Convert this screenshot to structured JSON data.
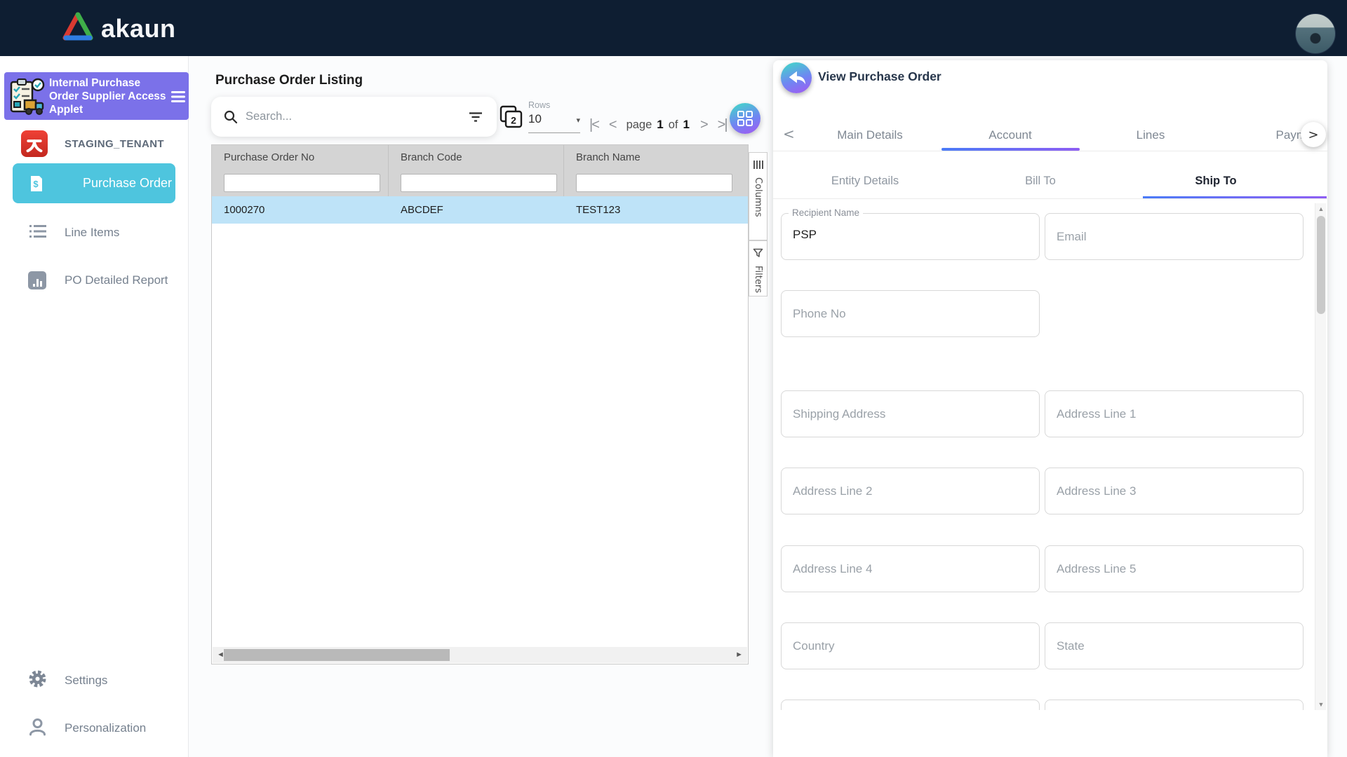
{
  "navbar": {
    "logo_text": "akaun"
  },
  "sidebar": {
    "applet_title": "Internal Purchase Order Supplier Access Applet",
    "tenant": {
      "label": "STAGING_TENANT"
    },
    "items": [
      {
        "label": "Purchase Order",
        "active": true
      },
      {
        "label": "Line Items"
      },
      {
        "label": "PO Detailed Report"
      }
    ],
    "footer": [
      {
        "label": "Settings"
      },
      {
        "label": "Personalization"
      }
    ]
  },
  "listing": {
    "title": "Purchase Order Listing",
    "search": {
      "placeholder": "Search..."
    },
    "rows": {
      "label": "Rows",
      "value": "10"
    },
    "pagination": {
      "first": "|<",
      "prev": "<",
      "page_word": "page",
      "current": "1",
      "of_word": "of",
      "total": "1",
      "next": ">",
      "last": ">|"
    },
    "table": {
      "columns": [
        "Purchase Order No",
        "Branch Code",
        "Branch Name"
      ],
      "rows": [
        {
          "po_no": "1000270",
          "branch_code": "ABCDEF",
          "branch_name": "TEST123"
        }
      ]
    },
    "side_tabs": [
      {
        "label": "Columns"
      },
      {
        "label": "Filters"
      }
    ]
  },
  "detail": {
    "title": "View Purchase Order",
    "tabs": [
      {
        "label": "Main Details"
      },
      {
        "label": "Account",
        "active": true
      },
      {
        "label": "Lines"
      },
      {
        "label": "Paym"
      }
    ],
    "sub_tabs": [
      {
        "label": "Entity Details"
      },
      {
        "label": "Bill To"
      },
      {
        "label": "Ship To",
        "active": true
      }
    ],
    "fields": {
      "recipient_name": {
        "label": "Recipient Name",
        "value": "PSP"
      },
      "email": {
        "placeholder": "Email"
      },
      "phone_no": {
        "placeholder": "Phone No"
      },
      "shipping_address": {
        "placeholder": "Shipping Address"
      },
      "address_line_1": {
        "placeholder": "Address Line 1"
      },
      "address_line_2": {
        "placeholder": "Address Line 2"
      },
      "address_line_3": {
        "placeholder": "Address Line 3"
      },
      "address_line_4": {
        "placeholder": "Address Line 4"
      },
      "address_line_5": {
        "placeholder": "Address Line 5"
      },
      "country": {
        "placeholder": "Country"
      },
      "state": {
        "placeholder": "State"
      }
    }
  },
  "colors": {
    "navbar_bg": "#0e1e32",
    "applet_purple": "#7b71e9",
    "active_item_teal": "#4ec5de",
    "tenant_red": "#e03a2f",
    "row_selection_blue": "#bee3f8",
    "table_header_gray": "#d4d4d4",
    "button_gradient": [
      "#3edec6",
      "#a457f2"
    ],
    "tab_underline_gradient": [
      "#4a7bf7",
      "#8e5ef3"
    ]
  }
}
